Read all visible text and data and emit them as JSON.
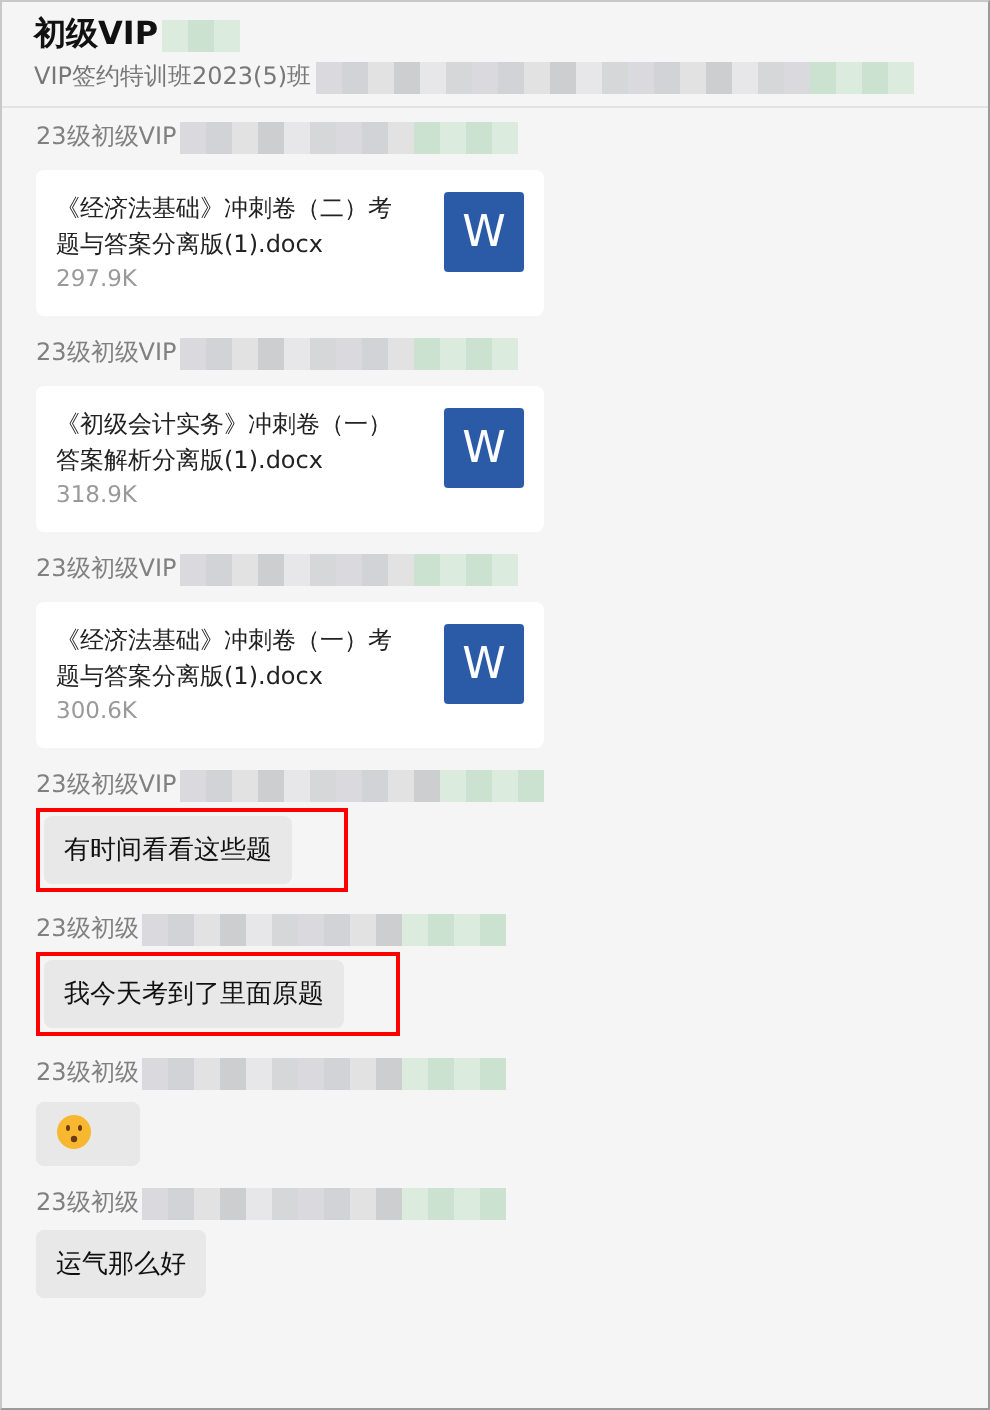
{
  "header": {
    "title": "初级VIP",
    "subtitle": "VIP签约特训班2023(5)班"
  },
  "messages": [
    {
      "sender": "23级初级VIP",
      "kind": "file",
      "file": {
        "name": "《经济法基础》冲刺卷（二）考题与答案分离版(1).docx",
        "size": "297.9K",
        "icon_letter": "W"
      },
      "highlighted": false
    },
    {
      "sender": "23级初级VIP",
      "kind": "file",
      "file": {
        "name": "《初级会计实务》冲刺卷（一）答案解析分离版(1).docx",
        "size": "318.9K",
        "icon_letter": "W"
      },
      "highlighted": false
    },
    {
      "sender": "23级初级VIP",
      "kind": "file",
      "file": {
        "name": "《经济法基础》冲刺卷（一）考题与答案分离版(1).docx",
        "size": "300.6K",
        "icon_letter": "W"
      },
      "highlighted": false
    },
    {
      "sender": "23级初级VIP",
      "kind": "text",
      "text": "有时间看看这些题",
      "highlighted": true
    },
    {
      "sender": "23级初级",
      "kind": "text",
      "text": "我今天考到了里面原题",
      "highlighted": true
    },
    {
      "sender": "23级初级",
      "kind": "emoji",
      "highlighted": false
    },
    {
      "sender": "23级初级",
      "kind": "text",
      "text": "运气那么好",
      "highlighted": false
    }
  ]
}
